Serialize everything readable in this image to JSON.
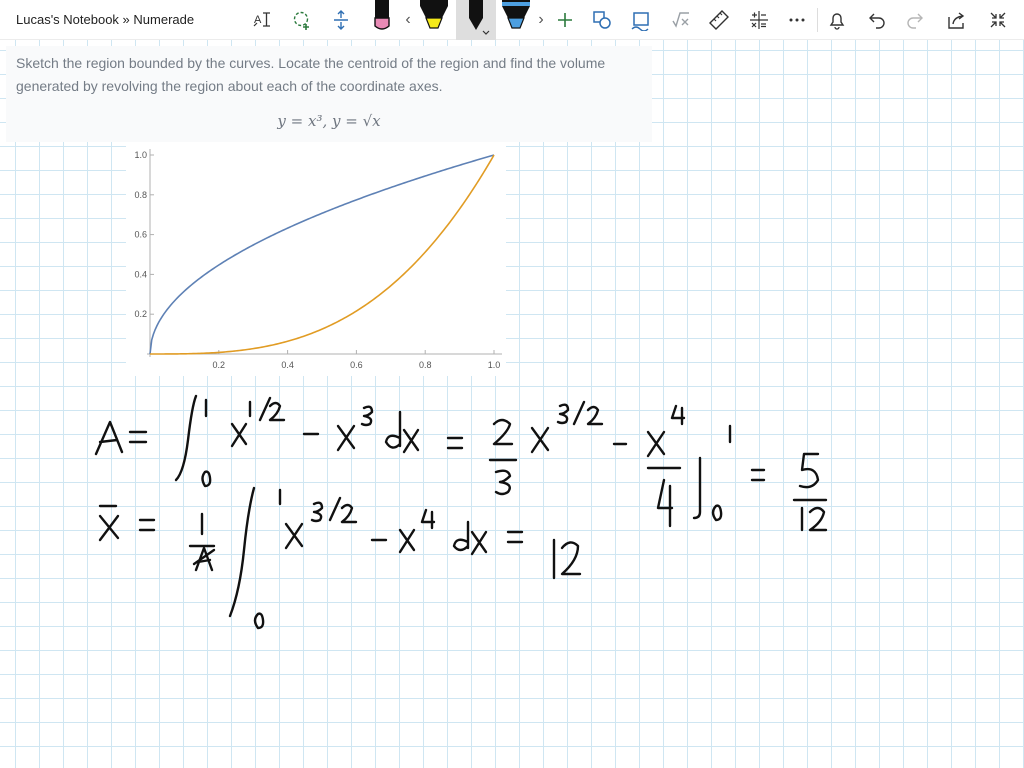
{
  "app": {
    "title": "Lucas's Notebook » Numerade"
  },
  "toolbar": {
    "icons": [
      "text-style-icon",
      "lasso-select-icon",
      "insert-space-icon",
      "pen-pink-icon",
      "scroll-left-icon",
      "highlighter-yellow-icon",
      "pen-black-icon",
      "highlighter-blue-icon",
      "scroll-right-icon",
      "add-pen-icon",
      "shapes-icon",
      "ink-to-shape-icon",
      "ink-to-math-icon",
      "ruler-icon",
      "math-icon",
      "more-icon",
      "notifications-icon",
      "undo-icon",
      "redo-icon",
      "share-icon",
      "fullscreen-icon"
    ],
    "scroll_left": "‹",
    "scroll_right": "›",
    "pen_colors": {
      "pink": "#e88ab5",
      "yellow": "#f5ea1a",
      "black": "#111111",
      "blue": "#4d9fe0"
    },
    "accent": "#2b7a3d"
  },
  "problem": {
    "text": "Sketch the region bounded by the curves. Locate the centroid of the region and find the volume generated by revolving the region about each of the coordinate axes.",
    "equation": "y = x³,   y = √x"
  },
  "chart_data": {
    "type": "line",
    "title": "",
    "xlabel": "",
    "ylabel": "",
    "xlim": [
      0,
      1
    ],
    "ylim": [
      0,
      1
    ],
    "x_ticks": [
      "0.2",
      "0.4",
      "0.6",
      "0.8",
      "1.0"
    ],
    "y_ticks": [
      "0.2",
      "0.4",
      "0.6",
      "0.8",
      "1.0"
    ],
    "grid": false,
    "legend": "none",
    "series": [
      {
        "color": "#5e81b5",
        "x": [
          0,
          0.01,
          0.02,
          0.05,
          0.1,
          0.15,
          0.2,
          0.3,
          0.4,
          0.5,
          0.6,
          0.7,
          0.8,
          0.9,
          1.0
        ],
        "y": [
          0,
          0.1,
          0.141,
          0.224,
          0.316,
          0.387,
          0.447,
          0.548,
          0.632,
          0.707,
          0.775,
          0.837,
          0.894,
          0.949,
          1.0
        ]
      },
      {
        "color": "#e19c24",
        "x": [
          0,
          0.1,
          0.2,
          0.3,
          0.4,
          0.5,
          0.6,
          0.7,
          0.8,
          0.9,
          1.0
        ],
        "y": [
          0,
          0.001,
          0.008,
          0.027,
          0.064,
          0.125,
          0.216,
          0.343,
          0.512,
          0.729,
          1.0
        ]
      }
    ]
  }
}
